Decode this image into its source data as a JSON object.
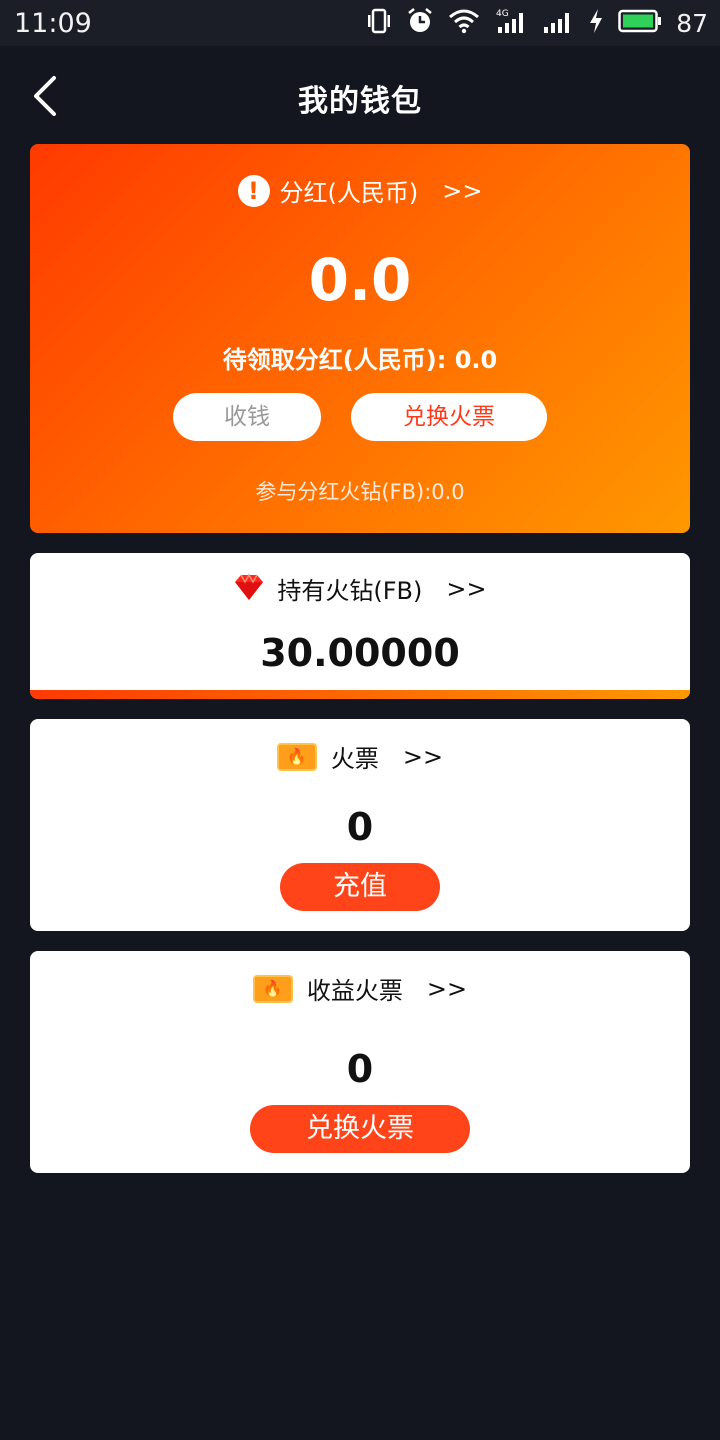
{
  "status_bar": {
    "time": "11:09",
    "battery": "87",
    "icons": [
      "vibrate-icon",
      "alarm-icon",
      "wifi-icon",
      "signal-4g-icon",
      "signal-icon",
      "charging-icon",
      "battery-icon"
    ]
  },
  "header": {
    "title": "我的钱包",
    "back_icon": "chevron-left-icon"
  },
  "dividend_card": {
    "title": "分红(人民币)",
    "arrows": ">>",
    "value": "0.0",
    "pending_label": "待领取分红(人民币):",
    "pending_value": "0.0",
    "collect_label": "收钱",
    "exchange_label": "兑换火票",
    "participate_label": "参与分红火钻(FB):0.0",
    "gradient": [
      "#ff3a00",
      "#ff9800"
    ]
  },
  "fb_card": {
    "title": "持有火钻(FB)",
    "arrows": ">>",
    "value": "30.00000"
  },
  "ticket_card": {
    "title": "火票",
    "arrows": ">>",
    "value": "0",
    "button_label": "充值"
  },
  "income_card": {
    "title": "收益火票",
    "arrows": ">>",
    "value": "0",
    "button_label": "兑换火票"
  },
  "colors": {
    "background": "#13151f",
    "accent": "#ff4419"
  }
}
